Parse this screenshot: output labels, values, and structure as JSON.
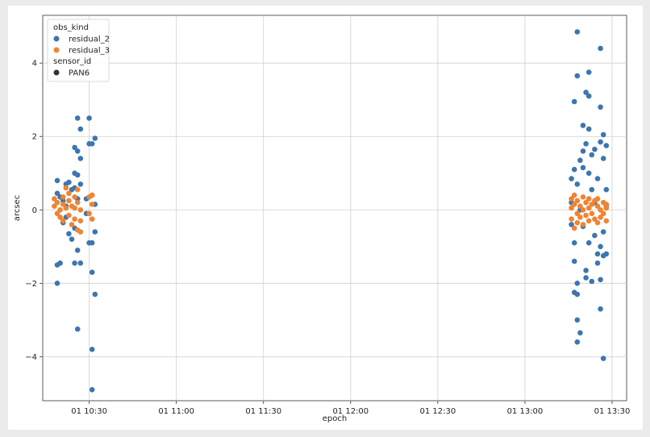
{
  "chart_data": {
    "type": "scatter",
    "title": "",
    "xlabel": "epoch",
    "ylabel": "arcsec",
    "x_ticks": [
      "01 10:30",
      "01 11:00",
      "01 11:30",
      "01 12:00",
      "01 12:30",
      "01 13:00",
      "01 13:30"
    ],
    "y_ticks": [
      "−4",
      "−2",
      "0",
      "2",
      "4"
    ],
    "xlim": [
      "10:14",
      "13:35"
    ],
    "ylim": [
      -5.2,
      5.3
    ],
    "grid": true,
    "legend": {
      "placement": "top-left",
      "hue_title": "obs_kind",
      "style_title": "sensor_id",
      "style_entries": [
        {
          "name": "PAN6",
          "color": "#333333"
        }
      ]
    },
    "series": [
      {
        "name": "residual_2",
        "color": "#3d76af",
        "points": [
          [
            "10:19",
            -2.0
          ],
          [
            "10:19",
            -1.5
          ],
          [
            "10:20",
            -1.45
          ],
          [
            "10:19",
            0.8
          ],
          [
            "10:19",
            0.45
          ],
          [
            "10:20",
            0.35
          ],
          [
            "10:21",
            0.25
          ],
          [
            "10:21",
            -0.35
          ],
          [
            "10:22",
            0.7
          ],
          [
            "10:22",
            0.1
          ],
          [
            "10:22",
            -0.2
          ],
          [
            "10:23",
            0.75
          ],
          [
            "10:23",
            -0.65
          ],
          [
            "10:24",
            0.55
          ],
          [
            "10:24",
            -0.8
          ],
          [
            "10:25",
            1.0
          ],
          [
            "10:25",
            1.7
          ],
          [
            "10:25",
            0.6
          ],
          [
            "10:25",
            -1.45
          ],
          [
            "10:25",
            -0.5
          ],
          [
            "10:26",
            2.5
          ],
          [
            "10:26",
            1.6
          ],
          [
            "10:26",
            0.95
          ],
          [
            "10:26",
            0.3
          ],
          [
            "10:26",
            -1.1
          ],
          [
            "10:26",
            -3.25
          ],
          [
            "10:27",
            2.2
          ],
          [
            "10:27",
            1.4
          ],
          [
            "10:27",
            -1.45
          ],
          [
            "10:27",
            0.7
          ],
          [
            "10:29",
            0.3
          ],
          [
            "10:29",
            -0.1
          ],
          [
            "10:30",
            2.5
          ],
          [
            "10:30",
            1.8
          ],
          [
            "10:30",
            -0.9
          ],
          [
            "10:31",
            1.8
          ],
          [
            "10:31",
            0.4
          ],
          [
            "10:31",
            -1.7
          ],
          [
            "10:31",
            -0.9
          ],
          [
            "10:31",
            -3.8
          ],
          [
            "10:31",
            -4.9
          ],
          [
            "10:32",
            1.95
          ],
          [
            "10:32",
            -2.3
          ],
          [
            "10:32",
            -0.6
          ],
          [
            "10:32",
            0.15
          ],
          [
            "13:16",
            0.85
          ],
          [
            "13:16",
            0.2
          ],
          [
            "13:16",
            -0.4
          ],
          [
            "13:17",
            2.95
          ],
          [
            "13:17",
            1.1
          ],
          [
            "13:17",
            -0.9
          ],
          [
            "13:17",
            -2.25
          ],
          [
            "13:17",
            -1.4
          ],
          [
            "13:18",
            4.85
          ],
          [
            "13:18",
            3.65
          ],
          [
            "13:18",
            0.7
          ],
          [
            "13:18",
            -2.3
          ],
          [
            "13:18",
            -2.0
          ],
          [
            "13:18",
            -3.0
          ],
          [
            "13:18",
            -3.6
          ],
          [
            "13:19",
            -3.35
          ],
          [
            "13:19",
            1.35
          ],
          [
            "13:19",
            0.0
          ],
          [
            "13:20",
            2.3
          ],
          [
            "13:20",
            1.6
          ],
          [
            "13:20",
            1.15
          ],
          [
            "13:20",
            -0.45
          ],
          [
            "13:21",
            3.2
          ],
          [
            "13:21",
            1.8
          ],
          [
            "13:21",
            -1.65
          ],
          [
            "13:21",
            -1.85
          ],
          [
            "13:22",
            3.75
          ],
          [
            "13:22",
            3.1
          ],
          [
            "13:22",
            2.2
          ],
          [
            "13:22",
            1.0
          ],
          [
            "13:22",
            -0.9
          ],
          [
            "13:23",
            1.5
          ],
          [
            "13:23",
            0.55
          ],
          [
            "13:23",
            -1.95
          ],
          [
            "13:24",
            1.65
          ],
          [
            "13:24",
            0.2
          ],
          [
            "13:24",
            -0.7
          ],
          [
            "13:25",
            0.85
          ],
          [
            "13:25",
            -1.45
          ],
          [
            "13:25",
            -1.2
          ],
          [
            "13:26",
            4.4
          ],
          [
            "13:26",
            2.8
          ],
          [
            "13:26",
            1.85
          ],
          [
            "13:26",
            -1.0
          ],
          [
            "13:26",
            -1.9
          ],
          [
            "13:26",
            -2.7
          ],
          [
            "13:27",
            2.05
          ],
          [
            "13:27",
            1.4
          ],
          [
            "13:27",
            -0.6
          ],
          [
            "13:27",
            -1.25
          ],
          [
            "13:27",
            -4.05
          ],
          [
            "13:28",
            1.75
          ],
          [
            "13:28",
            0.55
          ],
          [
            "13:28",
            -1.2
          ],
          [
            "13:28",
            0.1
          ]
        ]
      },
      {
        "name": "residual_3",
        "color": "#ee8434",
        "points": [
          [
            "10:18",
            0.3
          ],
          [
            "10:18",
            0.1
          ],
          [
            "10:19",
            -0.1
          ],
          [
            "10:19",
            0.2
          ],
          [
            "10:20",
            0.0
          ],
          [
            "10:20",
            -0.2
          ],
          [
            "10:21",
            0.15
          ],
          [
            "10:21",
            0.35
          ],
          [
            "10:21",
            -0.3
          ],
          [
            "10:22",
            0.6
          ],
          [
            "10:22",
            0.05
          ],
          [
            "10:23",
            -0.15
          ],
          [
            "10:23",
            0.25
          ],
          [
            "10:23",
            0.45
          ],
          [
            "10:24",
            0.1
          ],
          [
            "10:24",
            -0.4
          ],
          [
            "10:25",
            0.35
          ],
          [
            "10:25",
            0.05
          ],
          [
            "10:25",
            -0.25
          ],
          [
            "10:26",
            0.2
          ],
          [
            "10:26",
            -0.55
          ],
          [
            "10:26",
            0.55
          ],
          [
            "10:27",
            0.0
          ],
          [
            "10:27",
            -0.3
          ],
          [
            "10:27",
            -0.6
          ],
          [
            "10:30",
            0.35
          ],
          [
            "10:30",
            -0.1
          ],
          [
            "10:31",
            0.4
          ],
          [
            "10:31",
            0.15
          ],
          [
            "10:31",
            -0.25
          ],
          [
            "13:16",
            0.3
          ],
          [
            "13:16",
            0.05
          ],
          [
            "13:16",
            -0.25
          ],
          [
            "13:17",
            0.15
          ],
          [
            "13:17",
            -0.5
          ],
          [
            "13:17",
            0.4
          ],
          [
            "13:18",
            -0.1
          ],
          [
            "13:18",
            0.25
          ],
          [
            "13:18",
            -0.35
          ],
          [
            "13:19",
            0.1
          ],
          [
            "13:19",
            -0.2
          ],
          [
            "13:20",
            0.35
          ],
          [
            "13:20",
            0.0
          ],
          [
            "13:20",
            -0.4
          ],
          [
            "13:21",
            0.2
          ],
          [
            "13:21",
            -0.15
          ],
          [
            "13:22",
            0.3
          ],
          [
            "13:22",
            0.05
          ],
          [
            "13:22",
            -0.3
          ],
          [
            "13:23",
            0.15
          ],
          [
            "13:23",
            -0.1
          ],
          [
            "13:24",
            0.25
          ],
          [
            "13:24",
            -0.25
          ],
          [
            "13:25",
            0.1
          ],
          [
            "13:25",
            -0.35
          ],
          [
            "13:25",
            0.3
          ],
          [
            "13:26",
            0.0
          ],
          [
            "13:26",
            -0.2
          ],
          [
            "13:27",
            0.2
          ],
          [
            "13:27",
            -0.1
          ],
          [
            "13:28",
            0.15
          ],
          [
            "13:28",
            -0.3
          ],
          [
            "13:28",
            0.05
          ]
        ]
      }
    ]
  }
}
